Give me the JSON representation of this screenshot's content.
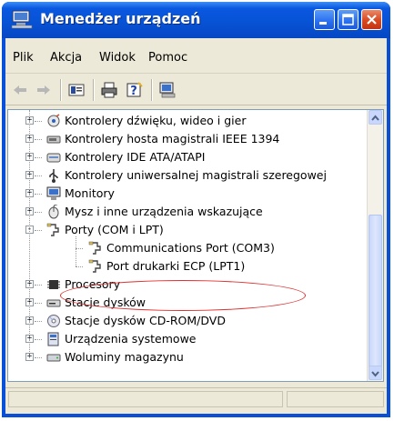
{
  "window": {
    "title": "Menedżer urządzeń",
    "accent_color": "#0a4fd8",
    "close_color": "#d9481f"
  },
  "menu": [
    {
      "label": "Plik"
    },
    {
      "label": "Akcja"
    },
    {
      "label": "Widok"
    },
    {
      "label": "Pomoc"
    }
  ],
  "toolbar": {
    "items": [
      {
        "name": "back-arrow-icon"
      },
      {
        "name": "forward-arrow-icon"
      },
      {
        "name": "properties-icon"
      },
      {
        "name": "print-icon"
      },
      {
        "name": "help-icon"
      },
      {
        "name": "computer-icon"
      }
    ]
  },
  "tree": {
    "items": [
      {
        "label": "Kontrolery dźwięku, wideo i gier",
        "icon": "sound-icon",
        "expander": "+"
      },
      {
        "label": "Kontrolery hosta magistrali IEEE 1394",
        "icon": "ieee1394-icon",
        "expander": "+"
      },
      {
        "label": "Kontrolery IDE ATA/ATAPI",
        "icon": "ide-controller-icon",
        "expander": "+"
      },
      {
        "label": "Kontrolery uniwersalnej magistrali szeregowej",
        "icon": "usb-icon",
        "expander": "+"
      },
      {
        "label": "Monitory",
        "icon": "monitor-icon",
        "expander": "+"
      },
      {
        "label": "Mysz i inne urządzenia wskazujące",
        "icon": "mouse-icon",
        "expander": "+"
      },
      {
        "label": "Porty (COM i LPT)",
        "icon": "port-icon",
        "expander": "-"
      },
      {
        "label": "Communications Port (COM3)",
        "icon": "port-icon",
        "expander": ""
      },
      {
        "label": "Port drukarki ECP (LPT1)",
        "icon": "port-icon",
        "expander": ""
      },
      {
        "label": "Procesory",
        "icon": "processor-icon",
        "expander": "+"
      },
      {
        "label": "Stacje dysków",
        "icon": "disk-drive-icon",
        "expander": "+"
      },
      {
        "label": "Stacje dysków CD-ROM/DVD",
        "icon": "cdrom-icon",
        "expander": "+"
      },
      {
        "label": "Urządzenia systemowe",
        "icon": "system-device-icon",
        "expander": "+"
      },
      {
        "label": "Woluminy magazynu",
        "icon": "volume-icon",
        "expander": "+"
      }
    ]
  },
  "annotation": {
    "color": "#e03030"
  }
}
